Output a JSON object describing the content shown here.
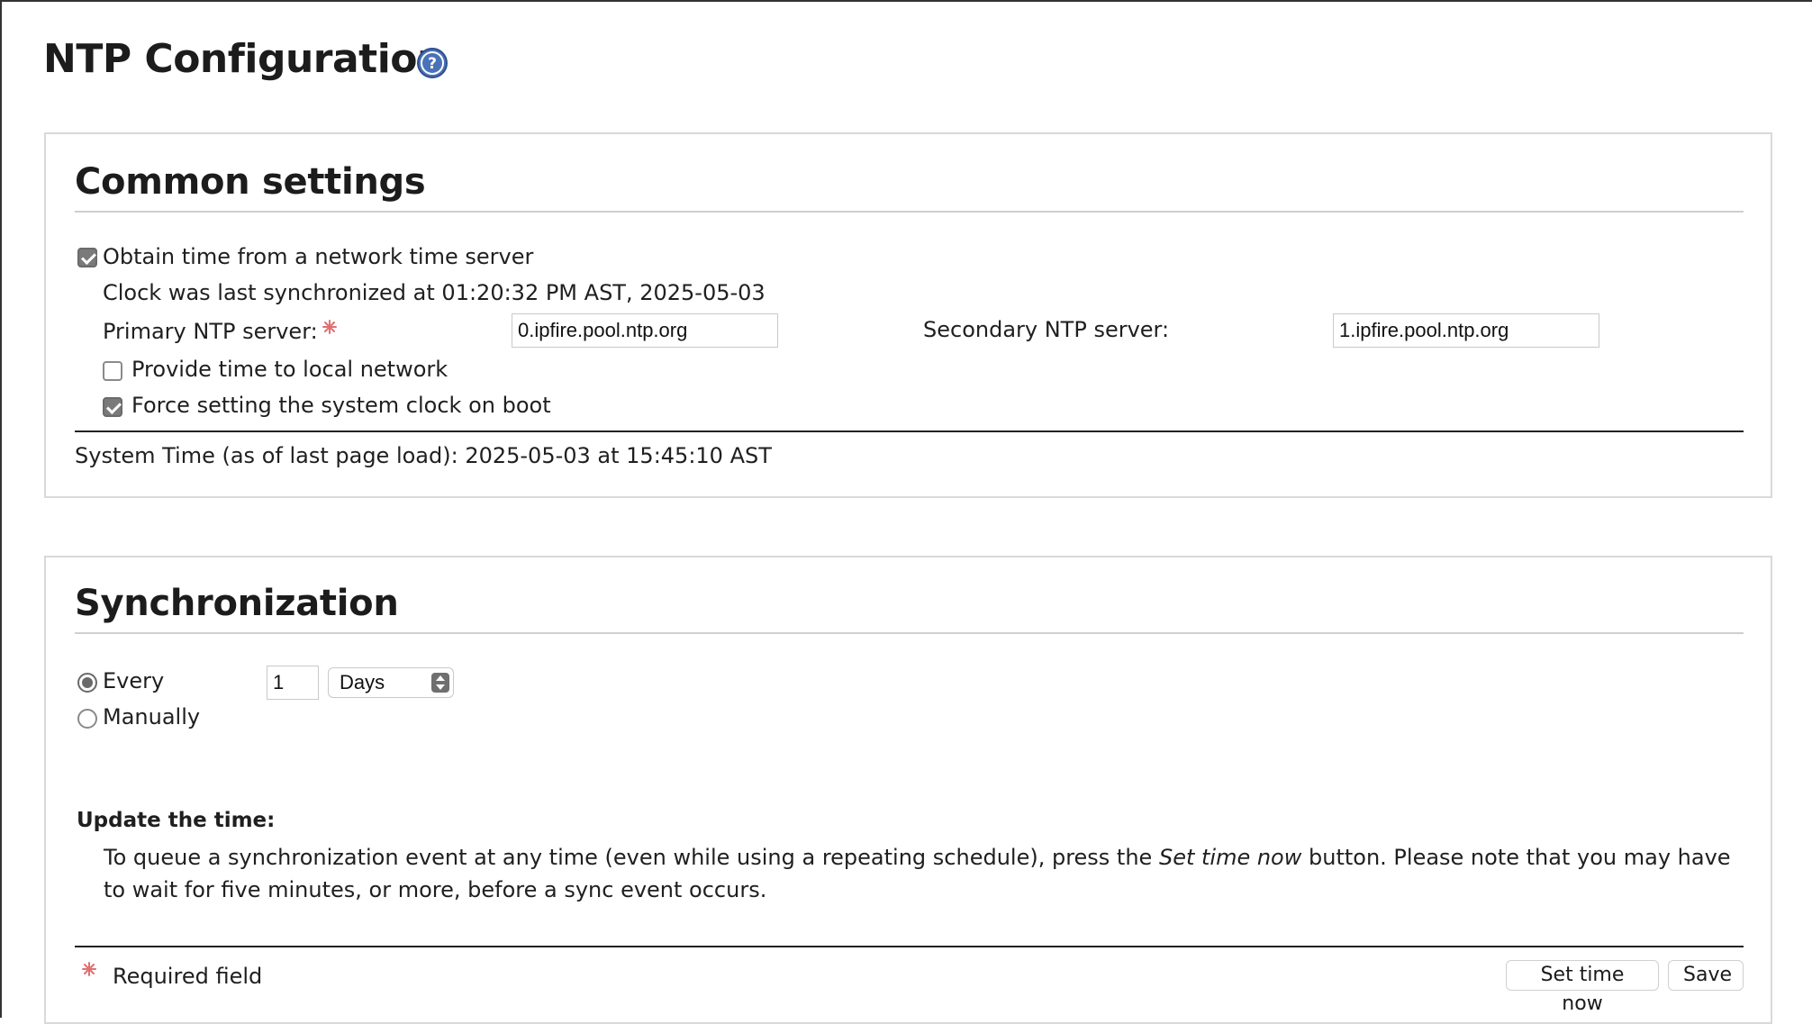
{
  "page": {
    "title": "NTP Configuration",
    "help_icon": "help-icon"
  },
  "common": {
    "title": "Common settings",
    "obtain_time_label": "Obtain time from a network time server",
    "obtain_time_checked": true,
    "last_sync_text": "Clock was last synchronized at 01:20:32 PM AST, 2025-05-03",
    "primary_label": "Primary NTP server:",
    "primary_value": "0.ipfire.pool.ntp.org",
    "secondary_label": "Secondary NTP server:",
    "secondary_value": "1.ipfire.pool.ntp.org",
    "provide_time_label": "Provide time to local network",
    "provide_time_checked": false,
    "force_clock_label": "Force setting the system clock on boot",
    "force_clock_checked": true,
    "system_time_text": "System Time (as of last page load): 2025-05-03 at 15:45:10 AST"
  },
  "sync": {
    "title": "Synchronization",
    "every_label": "Every",
    "every_selected": true,
    "interval_value": "1",
    "interval_unit": "Days",
    "manually_label": "Manually",
    "update_heading": "Update the time:",
    "update_text_before": "To queue a synchronization event at any time (even while using a repeating schedule), press the ",
    "update_text_em": "Set time now",
    "update_text_after": " button. Please note that you may have to wait for five minutes, or more, before a sync event occurs.",
    "required_field_label": "Required field",
    "set_time_button": "Set time now",
    "save_button": "Save"
  },
  "colors": {
    "asterisk": "#e07070",
    "help_icon": "#4a72b8"
  }
}
